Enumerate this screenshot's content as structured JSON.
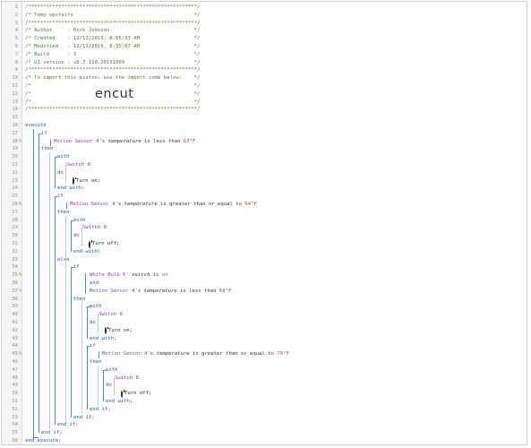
{
  "lines": [
    {
      "n": "1",
      "t": "/********************************************************/"
    },
    {
      "n": "2",
      "t": "/* Temp upstairs                                        */"
    },
    {
      "n": "3",
      "t": "/********************************************************/"
    },
    {
      "n": "4",
      "t": "/* Author     : Rick Johnson                            */"
    },
    {
      "n": "5",
      "t": "/* Created    : 12/11/2019, 8:05:33 AM                  */"
    },
    {
      "n": "6",
      "t": "/* Modified   : 12/11/2019, 8:35:07 AM                  */"
    },
    {
      "n": "7",
      "t": "/* Build      : 3                                       */"
    },
    {
      "n": "8",
      "t": "/* UI version : v0.3.110.20191009                       */"
    },
    {
      "n": "9",
      "t": "/********************************************************/"
    },
    {
      "n": "10",
      "t": "/* To import this piston, use the import code below:    */"
    },
    {
      "n": "11",
      "t": "/*                                                      */"
    },
    {
      "n": "12",
      "t": "/*                                                      */"
    },
    {
      "n": "13",
      "t": "/*                                                      */"
    },
    {
      "n": "14",
      "t": "/********************************************************/"
    }
  ],
  "import_code": "encut",
  "code": {
    "execute": "execute",
    "end_execute": "end execute;",
    "if": "if",
    "then": "then",
    "else": "else",
    "with": "with",
    "do": "do",
    "end_with": "end with;",
    "end_if": "end if;",
    "and": "and",
    "motion_sensor": "Motion Sensor 4",
    "s_temp": "'s ",
    "temperature": "temperature",
    "is_less_than": " is less than ",
    "is_ge": " is greater than or equal to ",
    "v63": "63°F",
    "v64": "64°F",
    "v68": "68°F",
    "v70": "70°F",
    "switch8": "Switch 8",
    "turn_on": "Turn on;",
    "turn_off": "Turn off;",
    "white_bulb": "White Bulb 6'",
    "switch_attr": " switch",
    "is": " is ",
    "on_val": "on"
  },
  "line_numbers_tail": [
    "15",
    "16",
    "17",
    "18",
    "19",
    "20",
    "21",
    "22",
    "23",
    "24",
    "25",
    "26",
    "27",
    "28",
    "29",
    "30",
    "31",
    "32",
    "33",
    "34",
    "35",
    "36",
    "37",
    "38",
    "39",
    "40",
    "41",
    "42",
    "43",
    "44",
    "45",
    "46",
    "47",
    "48",
    "49",
    "50",
    "51",
    "52",
    "53",
    "54",
    "55",
    "56"
  ],
  "warning_lines": [
    "18",
    "26",
    "35",
    "37",
    "45"
  ],
  "colors": {
    "accent": "#3d8ee0",
    "warning": "#e07a2e",
    "device": "#8a3dbd",
    "keyword": "#1c5aa6",
    "value": "#d0462f",
    "comment": "#4d7a2a"
  }
}
